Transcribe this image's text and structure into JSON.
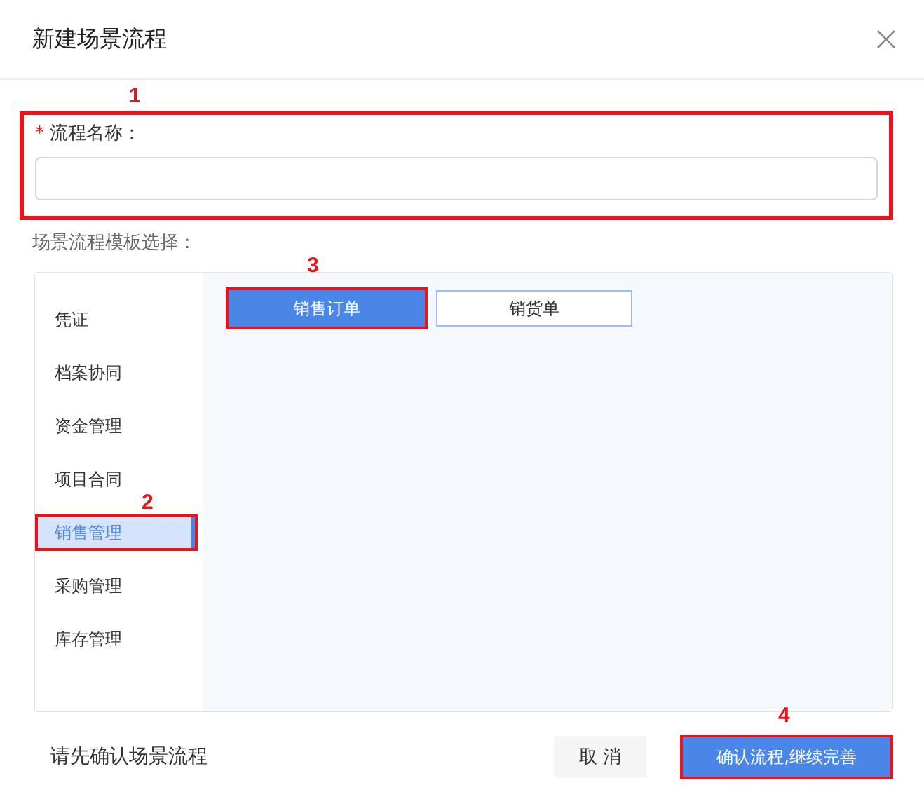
{
  "dialog": {
    "title": "新建场景流程"
  },
  "name_field": {
    "marker": "1",
    "required_mark": "*",
    "label": "流程名称：",
    "highlighted": true
  },
  "template_section": {
    "label": "场景流程模板选择："
  },
  "categories": [
    {
      "label": "凭证",
      "selected": false
    },
    {
      "label": "档案协同",
      "selected": false
    },
    {
      "label": "资金管理",
      "selected": false
    },
    {
      "label": "项目合同",
      "selected": false
    },
    {
      "label": "销售管理",
      "selected": true,
      "marker": "2",
      "highlighted": true
    },
    {
      "label": "采购管理",
      "selected": false
    },
    {
      "label": "库存管理",
      "selected": false
    }
  ],
  "templates": [
    {
      "label": "销售订单",
      "selected": true,
      "marker": "3",
      "highlighted": true
    },
    {
      "label": "销货单",
      "selected": false
    }
  ],
  "footer": {
    "hint": "请先确认场景流程",
    "cancel": "取 消",
    "confirm": "确认流程,继续完善",
    "confirm_marker": "4",
    "confirm_highlighted": true
  }
}
